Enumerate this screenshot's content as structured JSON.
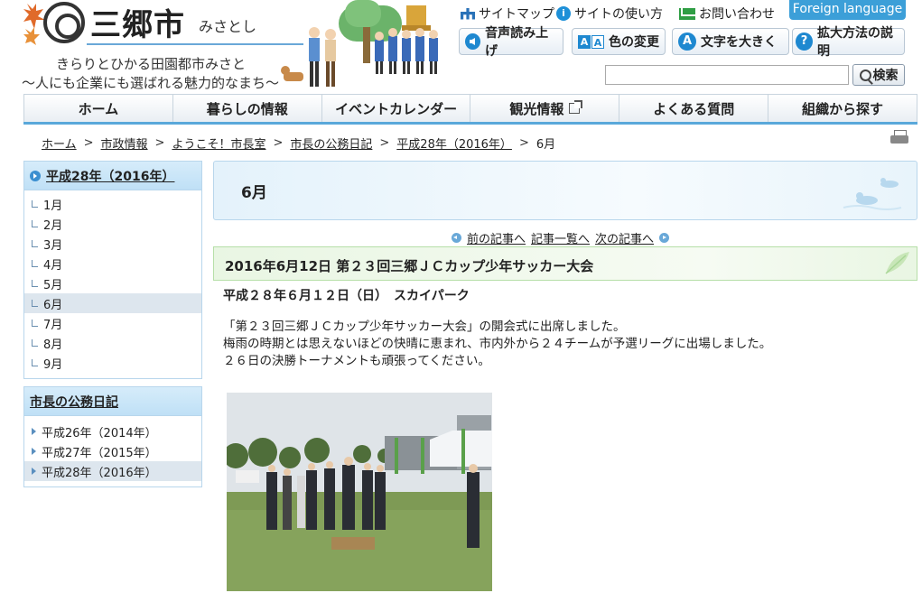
{
  "header": {
    "logo_name": "三郷市",
    "logo_kana": "みさとし",
    "tagline1": "きらりとひかる田園都市みさと",
    "tagline2": "～人にも企業にも選ばれる魅力的なまち～",
    "util_links": [
      "サイトマップ",
      "サイトの使い方",
      "お問い合わせ"
    ],
    "foreign_language": "Foreign language",
    "tools": {
      "speech": "音声読み上げ",
      "color": "色の変更",
      "fontsize": "文字を大きく",
      "zoom_help": "拡大方法の説明",
      "aa_icon": [
        "A",
        "A"
      ],
      "big_a": "A",
      "q": "?"
    },
    "search": {
      "placeholder": "",
      "button": "検索"
    }
  },
  "gnav": [
    "ホーム",
    "暮らしの情報",
    "イベントカレンダー",
    "観光情報",
    "よくある質問",
    "組織から探す"
  ],
  "breadcrumb": [
    "ホーム",
    "市政情報",
    "ようこそ！市長室",
    "市長の公務日記",
    "平成28年（2016年）",
    "6月"
  ],
  "sidebar": {
    "box1_title": "平成28年（2016年）",
    "months": [
      "1月",
      "2月",
      "3月",
      "4月",
      "5月",
      "6月",
      "7月",
      "8月",
      "9月"
    ],
    "active_month": "6月",
    "box2_title": "市長の公務日記",
    "years": [
      "平成26年（2014年）",
      "平成27年（2015年）",
      "平成28年（2016年）"
    ],
    "active_year": "平成28年（2016年）"
  },
  "main": {
    "page_title": "6月",
    "prev": "前の記事へ",
    "list": "記事一覧へ",
    "next": "次の記事へ",
    "article_title": "2016年6月12日 第２３回三郷ＪＣカップ少年サッカー大会",
    "date_line": "平成２８年６月１２日（日）　スカイパーク",
    "body": [
      "「第２３回三郷ＪＣカップ少年サッカー大会」の開会式に出席しました。",
      "梅雨の時期とは思えないほどの快晴に恵まれ、市内外から２４チームが予選リーグに出場しました。",
      "２６日の決勝トーナメントも頑張ってください。"
    ]
  },
  "colors": {
    "accent": "#5aa8da",
    "header_blue": "#3c9fd8",
    "green_head": "#e9f6e3"
  }
}
